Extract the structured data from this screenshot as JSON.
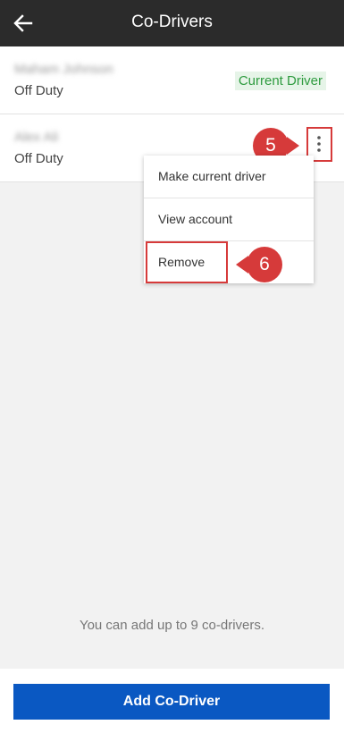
{
  "header": {
    "title": "Co-Drivers",
    "back_icon": "arrow-left-icon"
  },
  "drivers": [
    {
      "name": "Maham Johnson",
      "status": "Off Duty",
      "badge": "Current Driver"
    },
    {
      "name": "Alex Ali",
      "status": "Off Duty",
      "menu_icon": "more-vertical-icon"
    }
  ],
  "context_menu": {
    "items": [
      {
        "label": "Make current driver"
      },
      {
        "label": "View account"
      },
      {
        "label": "Remove"
      }
    ]
  },
  "annotations": {
    "step_5": "5",
    "step_6": "6"
  },
  "footer": {
    "note": "You can add up to 9 co-drivers.",
    "add_button_label": "Add Co-Driver"
  },
  "colors": {
    "header_bg": "#2b2b2b",
    "badge_text": "#2e9b3f",
    "badge_bg": "#e6f4e8",
    "primary_button": "#0a58c2",
    "annotation_red": "#d63a3a"
  }
}
